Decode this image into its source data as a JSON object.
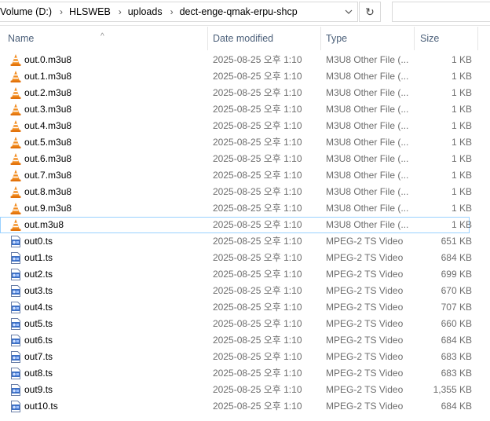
{
  "address": {
    "crumbs": [
      "Volume (D:)",
      "HLSWEB",
      "uploads",
      "dect-enge-qmak-erpu-shcp"
    ]
  },
  "columns": {
    "name": "Name",
    "date": "Date modified",
    "type": "Type",
    "size": "Size"
  },
  "files": [
    {
      "name": "out.0.m3u8",
      "date": "2025-08-25 오후 1:10",
      "type": "M3U8 Other File (...",
      "size": "1 KB",
      "icon": "vlc-cone-icon"
    },
    {
      "name": "out.1.m3u8",
      "date": "2025-08-25 오후 1:10",
      "type": "M3U8 Other File (...",
      "size": "1 KB",
      "icon": "vlc-cone-icon"
    },
    {
      "name": "out.2.m3u8",
      "date": "2025-08-25 오후 1:10",
      "type": "M3U8 Other File (...",
      "size": "1 KB",
      "icon": "vlc-cone-icon"
    },
    {
      "name": "out.3.m3u8",
      "date": "2025-08-25 오후 1:10",
      "type": "M3U8 Other File (...",
      "size": "1 KB",
      "icon": "vlc-cone-icon"
    },
    {
      "name": "out.4.m3u8",
      "date": "2025-08-25 오후 1:10",
      "type": "M3U8 Other File (...",
      "size": "1 KB",
      "icon": "vlc-cone-icon"
    },
    {
      "name": "out.5.m3u8",
      "date": "2025-08-25 오후 1:10",
      "type": "M3U8 Other File (...",
      "size": "1 KB",
      "icon": "vlc-cone-icon"
    },
    {
      "name": "out.6.m3u8",
      "date": "2025-08-25 오후 1:10",
      "type": "M3U8 Other File (...",
      "size": "1 KB",
      "icon": "vlc-cone-icon"
    },
    {
      "name": "out.7.m3u8",
      "date": "2025-08-25 오후 1:10",
      "type": "M3U8 Other File (...",
      "size": "1 KB",
      "icon": "vlc-cone-icon"
    },
    {
      "name": "out.8.m3u8",
      "date": "2025-08-25 오후 1:10",
      "type": "M3U8 Other File (...",
      "size": "1 KB",
      "icon": "vlc-cone-icon"
    },
    {
      "name": "out.9.m3u8",
      "date": "2025-08-25 오후 1:10",
      "type": "M3U8 Other File (...",
      "size": "1 KB",
      "icon": "vlc-cone-icon"
    },
    {
      "name": "out.m3u8",
      "date": "2025-08-25 오후 1:10",
      "type": "M3U8 Other File (...",
      "size": "1 KB",
      "icon": "vlc-cone-icon",
      "selected": true
    },
    {
      "name": "out0.ts",
      "date": "2025-08-25 오후 1:10",
      "type": "MPEG-2 TS Video",
      "size": "651 KB",
      "icon": "video-file-icon"
    },
    {
      "name": "out1.ts",
      "date": "2025-08-25 오후 1:10",
      "type": "MPEG-2 TS Video",
      "size": "684 KB",
      "icon": "video-file-icon"
    },
    {
      "name": "out2.ts",
      "date": "2025-08-25 오후 1:10",
      "type": "MPEG-2 TS Video",
      "size": "699 KB",
      "icon": "video-file-icon"
    },
    {
      "name": "out3.ts",
      "date": "2025-08-25 오후 1:10",
      "type": "MPEG-2 TS Video",
      "size": "670 KB",
      "icon": "video-file-icon"
    },
    {
      "name": "out4.ts",
      "date": "2025-08-25 오후 1:10",
      "type": "MPEG-2 TS Video",
      "size": "707 KB",
      "icon": "video-file-icon"
    },
    {
      "name": "out5.ts",
      "date": "2025-08-25 오후 1:10",
      "type": "MPEG-2 TS Video",
      "size": "660 KB",
      "icon": "video-file-icon"
    },
    {
      "name": "out6.ts",
      "date": "2025-08-25 오후 1:10",
      "type": "MPEG-2 TS Video",
      "size": "684 KB",
      "icon": "video-file-icon"
    },
    {
      "name": "out7.ts",
      "date": "2025-08-25 오후 1:10",
      "type": "MPEG-2 TS Video",
      "size": "683 KB",
      "icon": "video-file-icon"
    },
    {
      "name": "out8.ts",
      "date": "2025-08-25 오후 1:10",
      "type": "MPEG-2 TS Video",
      "size": "683 KB",
      "icon": "video-file-icon"
    },
    {
      "name": "out9.ts",
      "date": "2025-08-25 오후 1:10",
      "type": "MPEG-2 TS Video",
      "size": "1,355 KB",
      "icon": "video-file-icon"
    },
    {
      "name": "out10.ts",
      "date": "2025-08-25 오후 1:10",
      "type": "MPEG-2 TS Video",
      "size": "684 KB",
      "icon": "video-file-icon"
    }
  ],
  "colors": {
    "header_text": "#4c607a",
    "detail_text": "#6d6d6d",
    "selection_border": "#99d1ff",
    "vlc_orange": "#f28c1f"
  }
}
